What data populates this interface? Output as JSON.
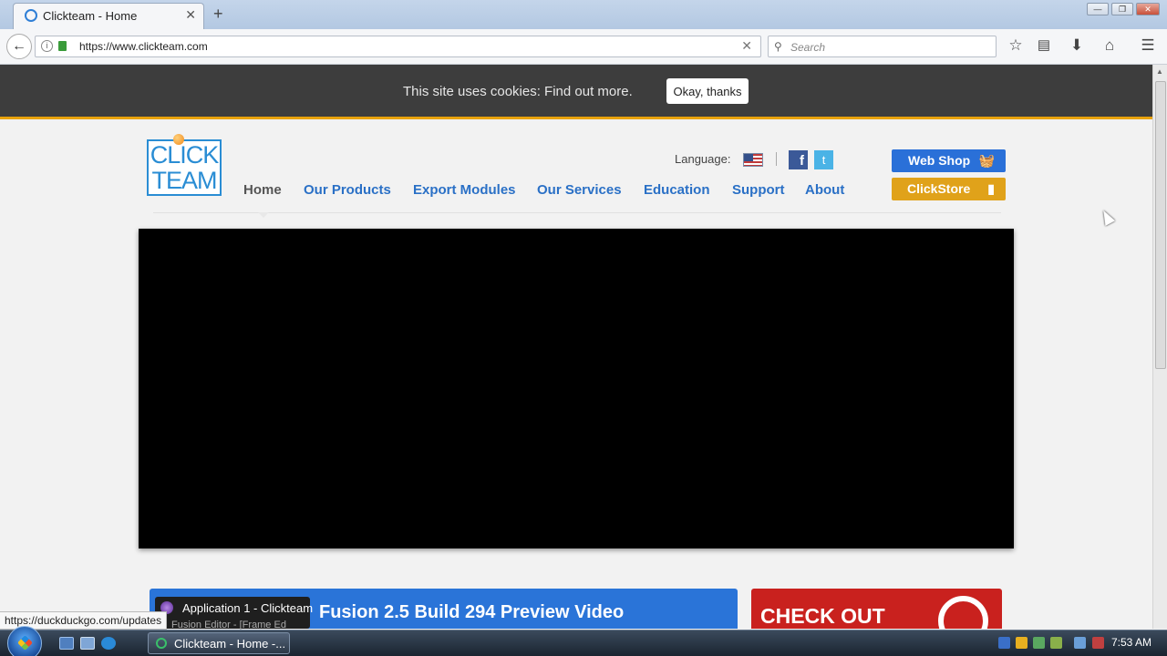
{
  "browser": {
    "tab_title": "Clickteam - Home",
    "tab_close": "✕",
    "new_tab": "+",
    "url": "https://www.clickteam.com",
    "url_clear": "✕",
    "search_placeholder": "Search",
    "window_controls": {
      "minimize": "—",
      "maximize": "❐",
      "close": "✕"
    },
    "back": "←",
    "toolbar_icons": [
      "bookmark-star-icon",
      "reading-list-icon",
      "downloads-icon",
      "home-icon",
      "menu-icon"
    ]
  },
  "cookie_banner": {
    "text": "This site uses cookies: Find out more.",
    "button": "Okay, thanks"
  },
  "logo": {
    "line1": "CLICK",
    "line2": "TEAM"
  },
  "nav": {
    "items": [
      {
        "label": "Home",
        "active": true
      },
      {
        "label": "Our Products"
      },
      {
        "label": "Export Modules"
      },
      {
        "label": "Our Services"
      },
      {
        "label": "Education"
      },
      {
        "label": "Support"
      },
      {
        "label": "About"
      }
    ]
  },
  "language": {
    "label": "Language:",
    "current_flag": "us-flag-icon"
  },
  "social": {
    "facebook": "f",
    "twitter": "t"
  },
  "buttons": {
    "webshop": "Web Shop",
    "clickstore": "ClickStore"
  },
  "promos": {
    "blue": "Fusion 2.5 Build 294 Preview Video",
    "red": "CHECK OUT"
  },
  "tooltip": {
    "title": "Application 1 - Clickteam",
    "subtitle": "Fusion Editor - [Frame Ed"
  },
  "status_url": "https://duckduckgo.com/updates",
  "taskbar": {
    "task_label": "Clickteam - Home -...",
    "clock": "7:53 AM"
  },
  "colors": {
    "accent_blue": "#2a70c6",
    "cookie_bg": "#3d3d3d",
    "cookie_border": "#e8a20b",
    "webshop": "#2a70d8",
    "clickstore": "#e0a21a",
    "promo_red": "#c9211e"
  }
}
